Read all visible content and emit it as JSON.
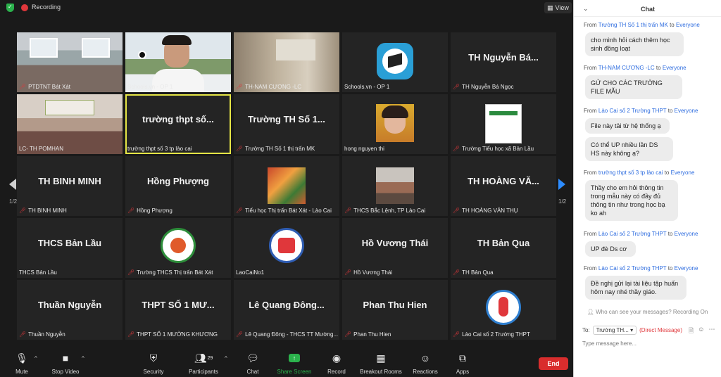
{
  "topbar": {
    "recording_label": "Recording",
    "view_label": "View"
  },
  "pagination": {
    "left": "1/2",
    "right": "1/2"
  },
  "tiles": [
    {
      "id": "t1",
      "kind": "photo",
      "name": "PTDTNT Bát Xát"
    },
    {
      "id": "t2",
      "kind": "photo",
      "name": "Schools.vn - OP 1"
    },
    {
      "id": "t3",
      "kind": "photo",
      "name": "TH-NAM CƯƠNG -LC"
    },
    {
      "id": "t4",
      "kind": "logo",
      "name": "Schools.vn - OP 1"
    },
    {
      "id": "t5",
      "kind": "text",
      "title": "TH Nguyễn Bá...",
      "name": "TH Nguyễn Bá Ngọc"
    },
    {
      "id": "t6",
      "kind": "photo",
      "name": "LC- TH POMHAN"
    },
    {
      "id": "t7",
      "kind": "text",
      "title": "trường thpt số...",
      "name": "trường thpt số 3 tp lào cai"
    },
    {
      "id": "t8",
      "kind": "text",
      "title": "Trường TH Số 1...",
      "name": "Trường TH Số 1  thị trấn MK"
    },
    {
      "id": "t9",
      "kind": "photo",
      "name": "hong nguyen thi"
    },
    {
      "id": "t10",
      "kind": "photo",
      "name": "Trường Tiểu học xã Bản Lầu"
    },
    {
      "id": "t11",
      "kind": "text",
      "title": "TH BINH MINH",
      "name": "TH BINH MINH"
    },
    {
      "id": "t12",
      "kind": "text",
      "title": "Hồng Phượng",
      "name": "Hồng Phượng"
    },
    {
      "id": "t13",
      "kind": "photo",
      "name": "Tiểu học Thị trấn Bát Xát - Lào Cai"
    },
    {
      "id": "t14",
      "kind": "photo",
      "name": "THCS Bắc Lệnh, TP Lào Cai"
    },
    {
      "id": "t15",
      "kind": "text",
      "title": "TH HOÀNG VĂ...",
      "name": "TH HOÀNG VĂN THỤ"
    },
    {
      "id": "t16",
      "kind": "text",
      "title": "THCS Bản Lầu",
      "name": "THCS Bản Lầu"
    },
    {
      "id": "t17",
      "kind": "logo",
      "name": "Trường THCS Thị trấn Bát Xát"
    },
    {
      "id": "t18",
      "kind": "logo",
      "name": "LaoCaiNo1"
    },
    {
      "id": "t19",
      "kind": "text",
      "title": "Hồ Vương Thái",
      "name": "Hồ Vương Thái"
    },
    {
      "id": "t20",
      "kind": "text",
      "title": "TH Bản Qua",
      "name": "TH Bản Qua"
    },
    {
      "id": "t21",
      "kind": "text",
      "title": "Thuần Nguyễn",
      "name": "Thuần Nguyễn"
    },
    {
      "id": "t22",
      "kind": "text",
      "title": "THPT SỐ 1 MƯ...",
      "name": "THPT SỐ 1 MƯỜNG KHƯƠNG"
    },
    {
      "id": "t23",
      "kind": "text",
      "title": "Lê Quang Đông...",
      "name": "Lê Quang Đông - THCS TT Mường..."
    },
    {
      "id": "t24",
      "kind": "text",
      "title": "Phan Thu Hien",
      "name": "Phan Thu Hien"
    },
    {
      "id": "t25",
      "kind": "logo",
      "name": "Lào Cai số 2 Trường THPT"
    }
  ],
  "toolbar": {
    "mute": "Mute",
    "video": "Stop Video",
    "security": "Security",
    "participants": "Participants",
    "participants_count": "29",
    "chat": "Chat",
    "share": "Share Screen",
    "record": "Record",
    "breakout": "Breakout Rooms",
    "reactions": "Reactions",
    "apps": "Apps",
    "end": "End"
  },
  "chat": {
    "title": "Chat",
    "messages": [
      {
        "from": "Trường TH Số 1  thị trấn MK",
        "to": "Everyone",
        "text": "cho mình hỏi cách thêm học sinh đồng loạt"
      },
      {
        "from": "TH-NAM CƯƠNG -LC",
        "to": "Everyone",
        "text": "GỬ CHO CÁC TRƯỜNG FILE MẪU"
      },
      {
        "from": "Lào Cai số 2 Trường THPT",
        "to": "Everyone",
        "text": "File này tải từ hệ thống ạ"
      },
      {
        "from": "",
        "to": "",
        "text": "Có thể UP nhiều lần DS HS này không ạ?"
      },
      {
        "from": "trường thpt số 3 tp lào cai",
        "to": "Everyone",
        "text": "Thầy cho em hỏi thông tin trong mẫu này có đầy đủ thông tin như trong học bạ ko ah"
      },
      {
        "from": "Lào Cai số 2 Trường THPT",
        "to": "Everyone",
        "text": "UP đè Ds cơ"
      },
      {
        "from": "Lào Cai số 2 Trường THPT",
        "to": "Everyone",
        "text": "Đề nghị gửi lại tài liệu tập huấn hôm nay nhé thầy giáo."
      }
    ],
    "from_word": "From",
    "to_word": "to",
    "privacy_note": "Who can see your messages? Recording On",
    "to_label": "To:",
    "recipient": "Trường TH...",
    "direct": "(Direct Message)",
    "placeholder": "Type message here..."
  }
}
